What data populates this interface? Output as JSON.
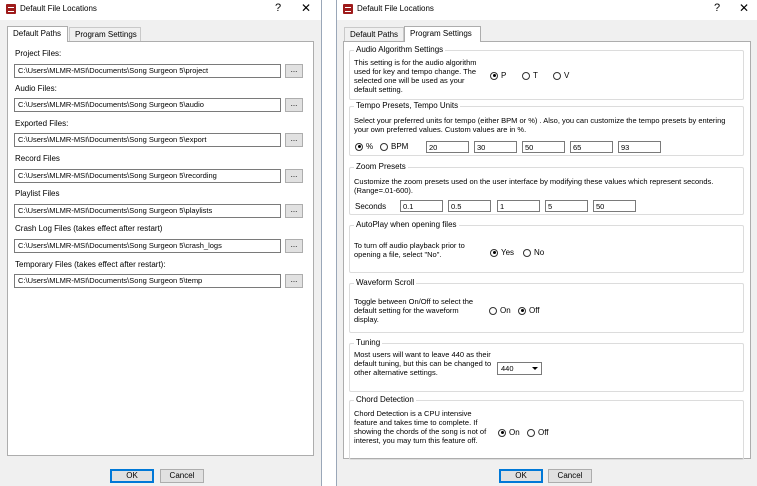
{
  "left_dialog": {
    "title": "Default File Locations",
    "help_icon": "?",
    "close_icon": "✕",
    "tabs": [
      {
        "label": "Default Paths",
        "active": true
      },
      {
        "label": "Program Settings",
        "active": false
      }
    ],
    "fields": [
      {
        "label": "Project Files:",
        "value": "C:\\Users\\MLMR-MSI\\Documents\\Song Surgeon 5\\project"
      },
      {
        "label": "Audio Files:",
        "value": "C:\\Users\\MLMR-MSI\\Documents\\Song Surgeon 5\\audio"
      },
      {
        "label": "Exported Files:",
        "value": "C:\\Users\\MLMR-MSI\\Documents\\Song Surgeon 5\\export"
      },
      {
        "label": "Record Files",
        "value": "C:\\Users\\MLMR-MSI\\Documents\\Song Surgeon 5\\recording"
      },
      {
        "label": "Playlist Files",
        "value": "C:\\Users\\MLMR-MSI\\Documents\\Song Surgeon 5\\playlists"
      },
      {
        "label": "Crash Log Files (takes effect after restart)",
        "value": "C:\\Users\\MLMR-MSI\\Documents\\Song Surgeon 5\\crash_logs"
      },
      {
        "label": "Temporary Files (takes effect after restart):",
        "value": "C:\\Users\\MLMR-MSI\\Documents\\Song Surgeon 5\\temp"
      }
    ],
    "browse_label": "...",
    "ok_label": "OK",
    "cancel_label": "Cancel"
  },
  "right_dialog": {
    "title": "Default File Locations",
    "help_icon": "?",
    "close_icon": "✕",
    "tabs": [
      {
        "label": "Default Paths",
        "active": false
      },
      {
        "label": "Program Settings",
        "active": true
      }
    ],
    "audio_algorithm": {
      "legend": "Audio Algorithm Settings",
      "text": "This setting is for the audio algorithm used for key and tempo change. The selected one will be used as your default setting.",
      "options": [
        "P",
        "T",
        "V"
      ],
      "selected": "P"
    },
    "tempo": {
      "legend": "Tempo Presets, Tempo Units",
      "text": "Select your preferred units for tempo (either BPM or %) . Also, you can customize the tempo presets by entering your own preferred values. Custom values are in %.",
      "options": [
        "%",
        "BPM"
      ],
      "selected": "%",
      "values": [
        "20",
        "30",
        "50",
        "65",
        "93"
      ]
    },
    "zoom": {
      "legend": "Zoom Presets",
      "text": "Customize the zoom presets used on the user interface by modifying these values which represent seconds. (Range=.01-600).",
      "seconds_label": "Seconds",
      "values": [
        "0.1",
        "0.5",
        "1",
        "5",
        "50"
      ]
    },
    "autoplay": {
      "legend": "AutoPlay when opening files",
      "text": "To turn off audio playback prior to opening a file, select \"No\".",
      "options": [
        "Yes",
        "No"
      ],
      "selected": "Yes"
    },
    "waveform": {
      "legend": "Waveform Scroll",
      "text": "Toggle between On/Off to select the default setting for the waveform display.",
      "options": [
        "On",
        "Off"
      ],
      "selected": "Off"
    },
    "tuning": {
      "legend": "Tuning",
      "text": "Most users will want to leave 440 as their default tuning, but this can be changed to other alternative settings.",
      "value": "440"
    },
    "chord": {
      "legend": "Chord Detection",
      "text": "Chord Detection is a CPU intensive feature and takes time to complete. If showing the chords of the song is not of interest, you may turn this feature off.",
      "options": [
        "On",
        "Off"
      ],
      "selected": "On"
    },
    "ok_label": "OK",
    "cancel_label": "Cancel"
  }
}
